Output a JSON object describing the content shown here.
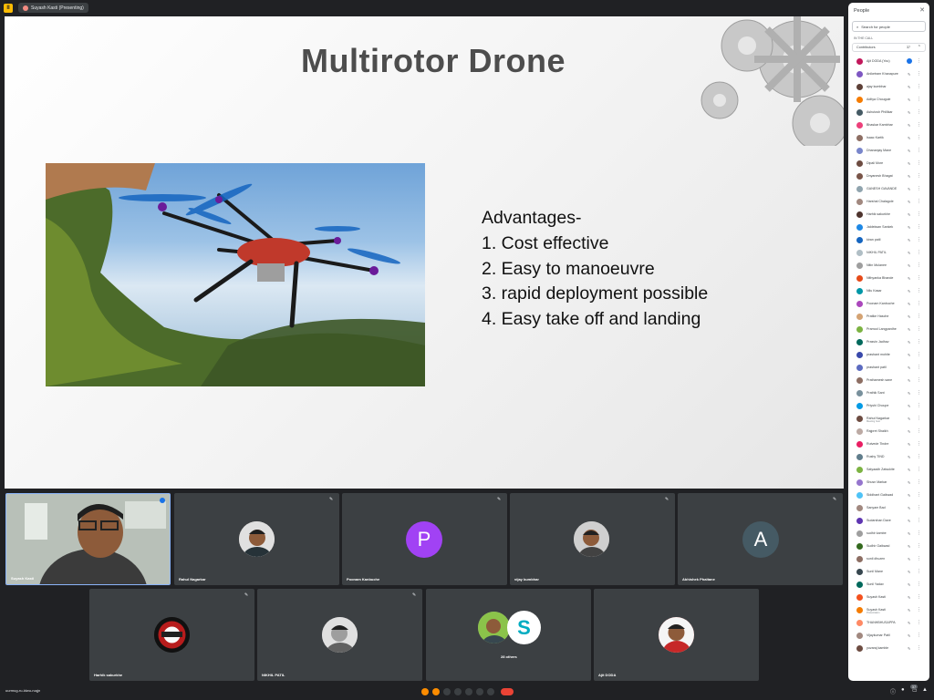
{
  "window": {
    "app_badge": "II",
    "presenting_chip": "Suyash Kasti (Presenting)"
  },
  "slide": {
    "title": "Multirotor Drone",
    "advantages_heading": "Advantages-",
    "advantages": [
      "1. Cost effective",
      "2. Easy to manoeuvre",
      "3. rapid deployment possible",
      "4. Easy take off and landing"
    ]
  },
  "tiles": [
    {
      "name": "Suyash Kasti",
      "kind": "self"
    },
    {
      "name": "Rahul Nagarkar",
      "kind": "photo"
    },
    {
      "name": "Poonam Kanbuche",
      "kind": "letter",
      "letter": "P",
      "color": "#a142f4"
    },
    {
      "name": "vijay kumbhar",
      "kind": "photo"
    },
    {
      "name": "Abhishek Phaltane",
      "kind": "letter",
      "letter": "A",
      "color": "#455a64"
    },
    {
      "name": "Harhik sakurkhe",
      "kind": "logo"
    },
    {
      "name": "NIKHIL PATIL",
      "kind": "photo"
    },
    {
      "name": "28 others",
      "kind": "group",
      "letter": "S"
    },
    {
      "name": "Ajit DODA",
      "kind": "photo"
    }
  ],
  "people": {
    "title": "People",
    "search_placeholder": "Search for people",
    "section_label": "IN THE CALL",
    "group_label": "Contributors",
    "group_count": "37",
    "list": [
      {
        "name": "Ajit DODA (You)",
        "color": "#c2185b",
        "blue": true
      },
      {
        "name": "Aniketram Khanapure",
        "color": "#7e57c2"
      },
      {
        "name": "ajay kumbhar",
        "color": "#5d4037"
      },
      {
        "name": "Aditya Chougule",
        "color": "#f57c00"
      },
      {
        "name": "Ashutosh Phillikar",
        "color": "#455a64"
      },
      {
        "name": "Bhaskar Kambhar",
        "color": "#ec407a"
      },
      {
        "name": "Isaac Kartik",
        "color": "#8d6e63"
      },
      {
        "name": "Dhananjay Mane",
        "color": "#7986cb"
      },
      {
        "name": "Dipali More",
        "color": "#6d4c41"
      },
      {
        "name": "Dnyanesh Bhagat",
        "color": "#795548"
      },
      {
        "name": "GANESH GAVANDE",
        "color": "#90a4ae"
      },
      {
        "name": "Harshal Chalagole",
        "color": "#a1887f"
      },
      {
        "name": "Harhik sakurkhe",
        "color": "#4e342e"
      },
      {
        "name": "Jaldeksan Sankek",
        "color": "#1e88e5"
      },
      {
        "name": "kiran patil",
        "color": "#1565c0"
      },
      {
        "name": "NIKHIL PATIL",
        "color": "#b0bec5"
      },
      {
        "name": "Nitin Mulanee",
        "color": "#9e9e9e"
      },
      {
        "name": "Nithyanka Bhande",
        "color": "#e64a19"
      },
      {
        "name": "Nilu Kasar",
        "color": "#0097a7"
      },
      {
        "name": "Poonam Kanbuche",
        "color": "#ab47bc"
      },
      {
        "name": "Pratike Hasche",
        "color": "#d4a373"
      },
      {
        "name": "Pramod Langpardhe",
        "color": "#7cb342"
      },
      {
        "name": "Prasvin Jadhav",
        "color": "#00695c"
      },
      {
        "name": "prashant mohite",
        "color": "#3949ab"
      },
      {
        "name": "prashant patil",
        "color": "#5c6bc0"
      },
      {
        "name": "Prathamesh sane",
        "color": "#8d6e63"
      },
      {
        "name": "Prathik Sant",
        "color": "#78909c"
      },
      {
        "name": "Priyshi Choupe",
        "color": "#039be5"
      },
      {
        "name": "Rahul Nagarkar",
        "color": "#6d4c41",
        "sub": "Meeting host"
      },
      {
        "name": "Rajpret Shaikh",
        "color": "#bcaaa4"
      },
      {
        "name": "Rutvede Tindre",
        "color": "#e91e63"
      },
      {
        "name": "Rushy TIND",
        "color": "#607d8b"
      },
      {
        "name": "Satyaadh Zatsukite",
        "color": "#7cb342"
      },
      {
        "name": "Shusn Markar",
        "color": "#9575cd"
      },
      {
        "name": "Siddhant Gaikwad",
        "color": "#4fc3f7"
      },
      {
        "name": "Sanyam Bad",
        "color": "#a1887f"
      },
      {
        "name": "Sudarshan Dave",
        "color": "#5e35b1"
      },
      {
        "name": "sudhir kambe",
        "color": "#9e9e9e"
      },
      {
        "name": "Sudhir Gaikwad",
        "color": "#33691e"
      },
      {
        "name": "sunil dhuzen",
        "color": "#8d6e63"
      },
      {
        "name": "Sunil Mane",
        "color": "#37474f"
      },
      {
        "name": "Sunil Yadav",
        "color": "#00695c"
      },
      {
        "name": "Suyash Kasti",
        "color": "#f4511e"
      },
      {
        "name": "Suyash Kasti",
        "color": "#f57c00",
        "sub": "Presentation"
      },
      {
        "name": "THANHBHUSAPPA",
        "color": "#ff8a65"
      },
      {
        "name": "Vijaykumar Patil",
        "color": "#a1887f"
      },
      {
        "name": "yuvaraj kamble",
        "color": "#6d4c41"
      }
    ]
  },
  "bottom": {
    "meeting_code": "uurmug-ru-ldwu-ruqjn",
    "people_count": "37"
  }
}
